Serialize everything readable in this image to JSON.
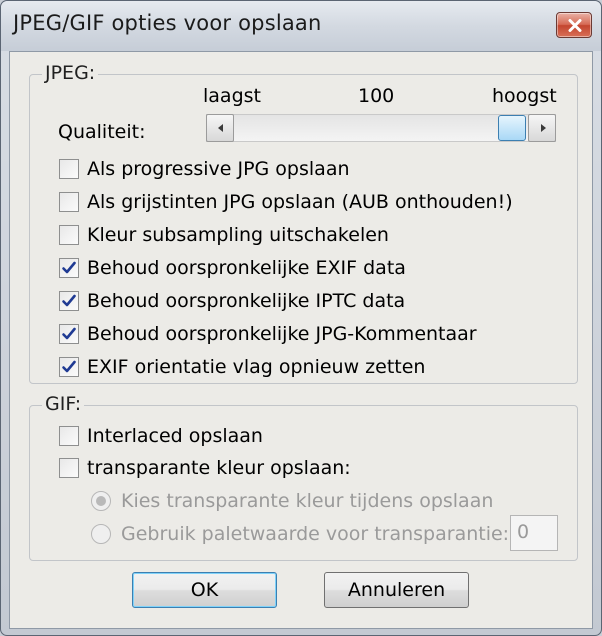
{
  "window": {
    "title": "JPEG/GIF opties voor opslaan"
  },
  "jpeg": {
    "legend": "JPEG:",
    "scale_low": "laagst",
    "scale_value": "100",
    "scale_high": "hoogst",
    "quality_label": "Qualiteit:",
    "quality": 100,
    "options": [
      {
        "label": "Als progressive JPG opslaan",
        "checked": false
      },
      {
        "label": "Als grijstinten JPG opslaan (AUB onthouden!)",
        "checked": false
      },
      {
        "label": "Kleur subsampling uitschakelen",
        "checked": false
      },
      {
        "label": "Behoud oorspronkelijke EXIF data",
        "checked": true
      },
      {
        "label": "Behoud oorspronkelijke IPTC data",
        "checked": true
      },
      {
        "label": "Behoud oorspronkelijke JPG-Kommentaar",
        "checked": true
      },
      {
        "label": "EXIF orientatie vlag opnieuw zetten",
        "checked": true
      }
    ]
  },
  "gif": {
    "legend": "GIF:",
    "interlaced_label": "Interlaced opslaan",
    "interlaced_checked": false,
    "transparent_label": "transparante kleur opslaan:",
    "transparent_checked": false,
    "radio_choose_label": "Kies transparante kleur tijdens opslaan",
    "radio_palette_label": "Gebruik paletwaarde voor transparantie:",
    "palette_value": "0"
  },
  "buttons": {
    "ok": "OK",
    "cancel": "Annuleren"
  }
}
